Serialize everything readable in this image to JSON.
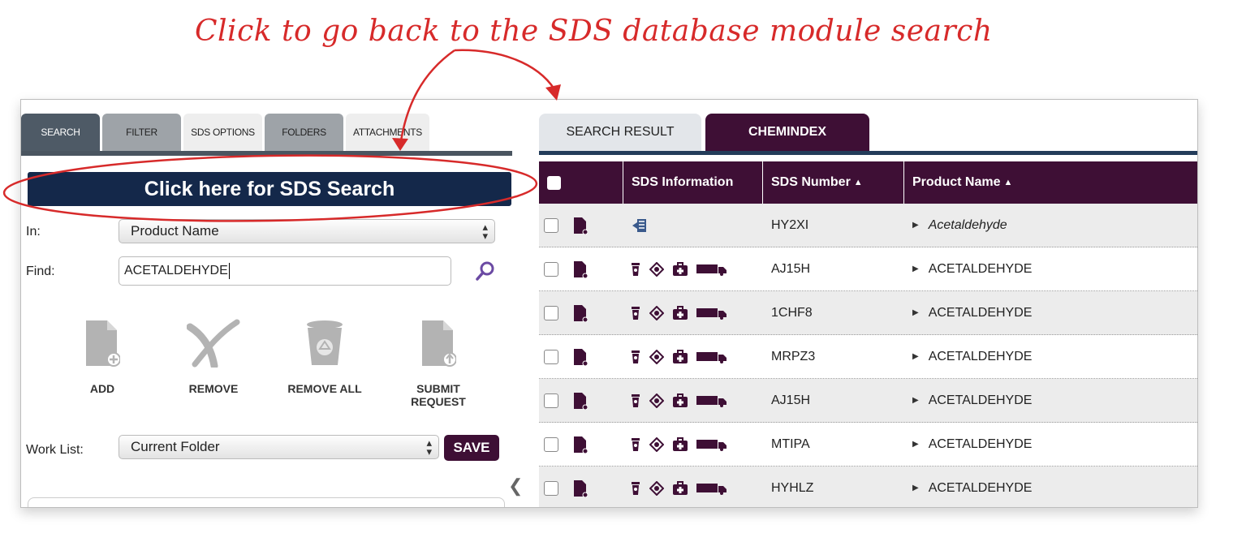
{
  "annotation": {
    "text": "Click to go back to the SDS database module search"
  },
  "left_panel": {
    "tabs": [
      "SEARCH",
      "FILTER",
      "SDS OPTIONS",
      "FOLDERS",
      "ATTACHMENTS"
    ],
    "sds_search_button": "Click here for SDS Search",
    "in_label": "In:",
    "in_value": "Product Name",
    "find_label": "Find:",
    "find_value": "ACETALDEHYDE",
    "actions": {
      "add": "ADD",
      "remove": "REMOVE",
      "remove_all": "REMOVE ALL",
      "submit_request": "SUBMIT REQUEST"
    },
    "worklist_label": "Work List:",
    "worklist_value": "Current Folder",
    "save_label": "SAVE"
  },
  "right_panel": {
    "tabs": [
      "SEARCH RESULT",
      "CHEMINDEX"
    ],
    "columns": [
      "SDS Information",
      "SDS Number",
      "Product Name"
    ],
    "rows": [
      {
        "sds_number": "HY2XI",
        "product_name": "Acetaldehyde"
      },
      {
        "sds_number": "AJ15H",
        "product_name": "ACETALDEHYDE"
      },
      {
        "sds_number": "1CHF8",
        "product_name": "ACETALDEHYDE"
      },
      {
        "sds_number": "MRPZ3",
        "product_name": "ACETALDEHYDE"
      },
      {
        "sds_number": "AJ15H",
        "product_name": "ACETALDEHYDE"
      },
      {
        "sds_number": "MTIPA",
        "product_name": "ACETALDEHYDE"
      },
      {
        "sds_number": "HYHLZ",
        "product_name": "ACETALDEHYDE"
      }
    ]
  },
  "colors": {
    "annotation": "#d72a2a",
    "navy": "#14284a",
    "plum": "#3e0f35",
    "tab_dark": "#4e5a66"
  }
}
